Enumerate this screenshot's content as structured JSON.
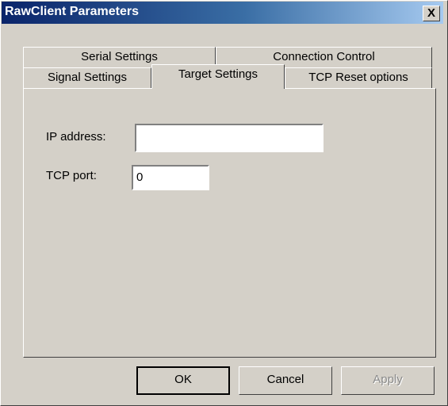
{
  "window": {
    "title": "RawClient Parameters",
    "close_label": "X"
  },
  "tabs_row1": [
    {
      "label": "Serial Settings"
    },
    {
      "label": "Connection Control"
    }
  ],
  "tabs_row2": [
    {
      "label": "Signal Settings"
    },
    {
      "label": "Target Settings",
      "selected": true
    },
    {
      "label": "TCP Reset options"
    }
  ],
  "fields": {
    "ip_label": "IP address:",
    "ip_value": "",
    "port_label": "TCP port:",
    "port_value": "0"
  },
  "buttons": {
    "ok": "OK",
    "cancel": "Cancel",
    "apply": "Apply"
  }
}
